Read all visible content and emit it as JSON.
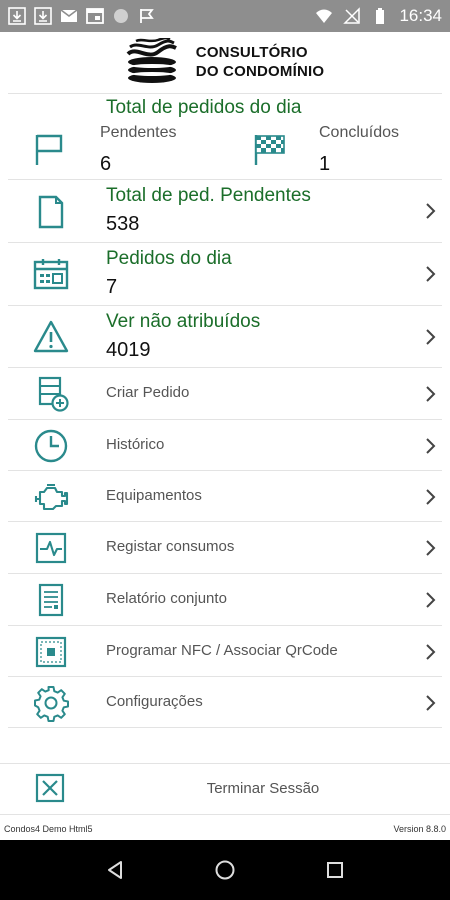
{
  "status_bar": {
    "time": "16:34"
  },
  "header": {
    "logo_line1": "CONSULTÓRIO",
    "logo_line2": "DO CONDOMÍNIO"
  },
  "summary": {
    "title": "Total de pedidos do dia",
    "pending_label": "Pendentes",
    "pending_value": "6",
    "done_label": "Concluídos",
    "done_value": "1"
  },
  "stats_rows": [
    {
      "title": "Total de ped. Pendentes",
      "value": "538"
    },
    {
      "title": "Pedidos do dia",
      "value": "7"
    },
    {
      "title": "Ver não atribuídos",
      "value": "4019"
    }
  ],
  "menu": [
    {
      "label": "Criar Pedido"
    },
    {
      "label": "Histórico"
    },
    {
      "label": "Equipamentos"
    },
    {
      "label": "Registar consumos"
    },
    {
      "label": "Relatório conjunto"
    },
    {
      "label": "Programar NFC / Associar QrCode"
    },
    {
      "label": "Configurações"
    }
  ],
  "logout_label": "Terminar Sessão",
  "footer": {
    "app_name": "Condos4 Demo Html5",
    "version": "Version 8.8.0"
  },
  "colors": {
    "accent_green": "#1b6e2a",
    "icon_teal": "#2a8a8c",
    "status_bar": "#8e8e8e"
  }
}
